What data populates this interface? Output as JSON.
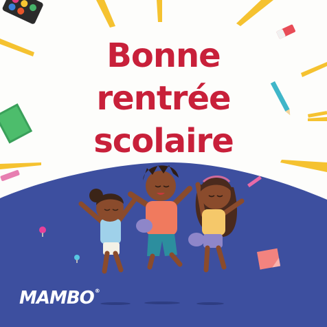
{
  "headline": {
    "line1": "Bonne",
    "line2": "rentrée",
    "line3": "scolaire"
  },
  "brand": {
    "name": "MAMBO",
    "mark": "®"
  },
  "colors": {
    "headline": "#c8203a",
    "ground": "#3d4f9f",
    "rays": "#f5c230",
    "background": "#fdfdfb"
  },
  "illustration": {
    "children": [
      "girl-left",
      "boy-center",
      "girl-right"
    ],
    "decorations": [
      "watercolor-palette-icon",
      "eraser-icon",
      "pencil-icon",
      "notebook-icon",
      "pushpin-icon",
      "sticky-note-icon"
    ]
  }
}
